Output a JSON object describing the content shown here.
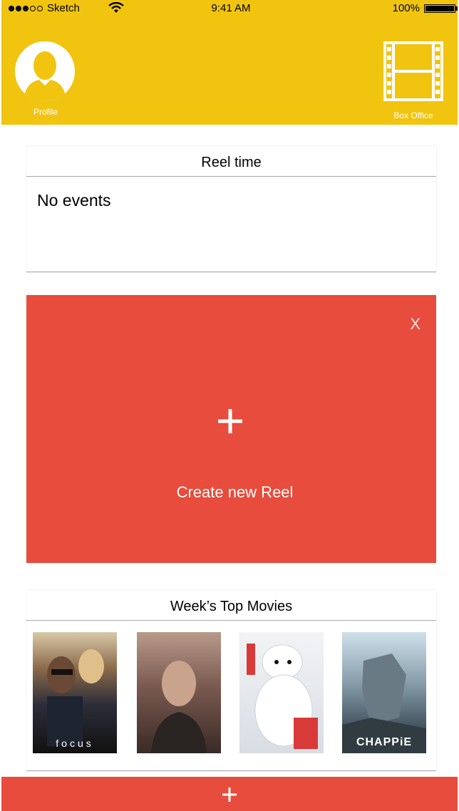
{
  "status_bar": {
    "carrier": "Sketch",
    "time": "9:41 AM",
    "battery": "100%",
    "battery_level": 1.0,
    "signal_bars": 3,
    "signal_total": 5
  },
  "header": {
    "profile_label": "Profile",
    "box_office_label": "Box Office",
    "background_color": "#F1C40F"
  },
  "reel_time": {
    "title": "Reel time",
    "empty_text": "No events"
  },
  "create_reel": {
    "close_label": "X",
    "label": "Create new Reel",
    "background_color": "#E74C3C"
  },
  "top_movies": {
    "title": "Week’s Top Movies",
    "posters": [
      {
        "title": "focus",
        "icon": "movie-poster-icon"
      },
      {
        "title": "",
        "icon": "movie-poster-icon"
      },
      {
        "title": "",
        "icon": "movie-poster-icon"
      },
      {
        "title": "CHAPPiE",
        "icon": "movie-poster-icon"
      }
    ]
  },
  "bottom_bar": {
    "icon": "plus-icon"
  }
}
